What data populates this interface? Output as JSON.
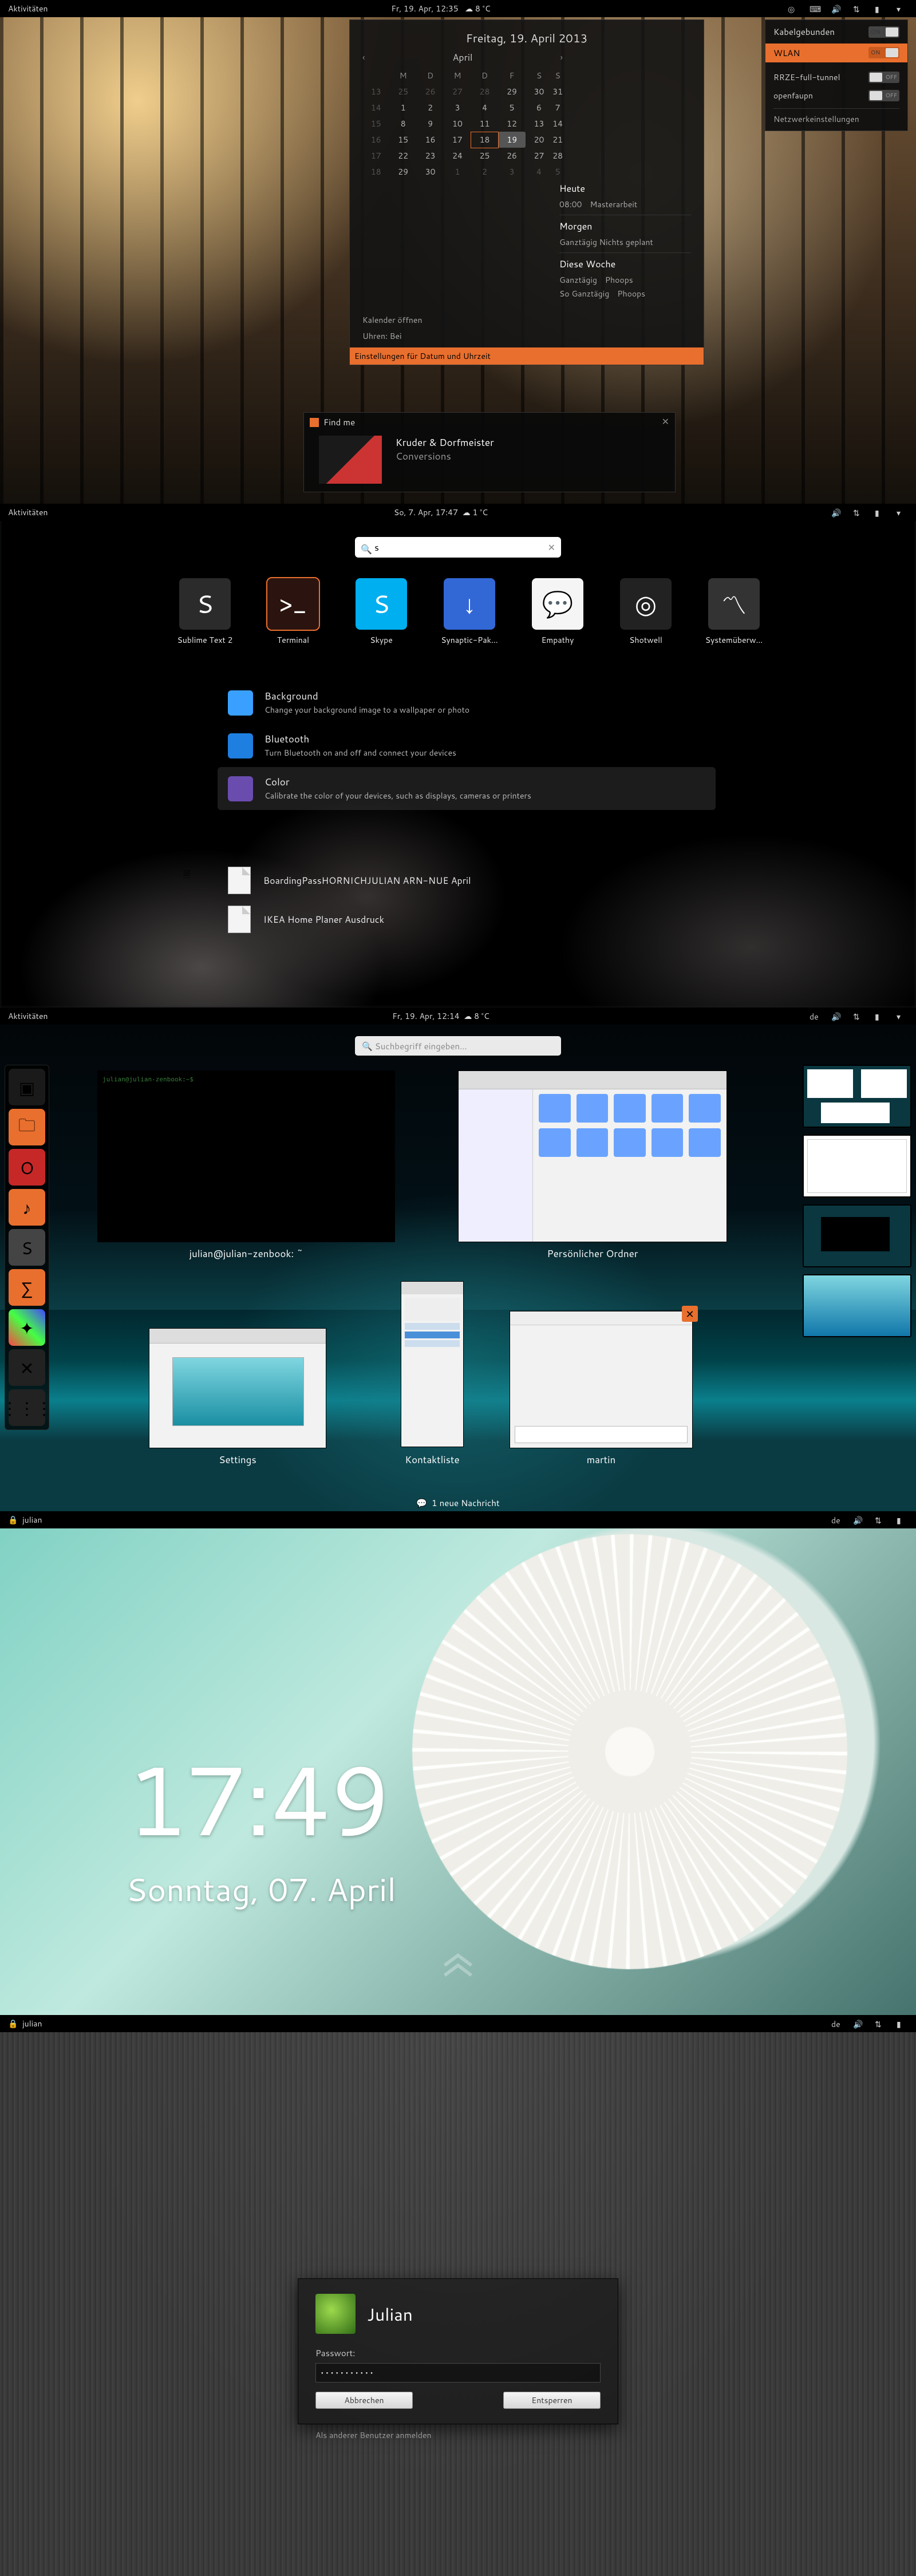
{
  "s1": {
    "topbar": {
      "activities": "Aktivitäten",
      "datetime": "Fr, 19. Apr, 12:35",
      "temp": "8 °C"
    },
    "calendar": {
      "title": "Freitag, 19. April 2013",
      "month": "April",
      "dow": [
        "M",
        "D",
        "M",
        "D",
        "F",
        "S",
        "S"
      ],
      "weeknums": [
        "13",
        "14",
        "15",
        "16",
        "17",
        "18"
      ],
      "days": [
        [
          "25",
          "26",
          "27",
          "28",
          "29",
          "30",
          "31"
        ],
        [
          "1",
          "2",
          "3",
          "4",
          "5",
          "6",
          "7"
        ],
        [
          "8",
          "9",
          "10",
          "11",
          "12",
          "13",
          "14"
        ],
        [
          "15",
          "16",
          "17",
          "18",
          "19",
          "20",
          "21"
        ],
        [
          "22",
          "23",
          "24",
          "25",
          "26",
          "27",
          "28"
        ],
        [
          "29",
          "30",
          "1",
          "2",
          "3",
          "4",
          "5"
        ]
      ],
      "today_r": 3,
      "today_c": 4,
      "hl_r": 3,
      "hl_c": 3,
      "agenda": {
        "today": "Heute",
        "today_time": "08:00",
        "today_text": "Masterarbeit",
        "tomorrow": "Morgen",
        "tomorrow_text": "Ganztägig   Nichts geplant",
        "week": "Diese Woche",
        "rows": [
          [
            "Ganztägig",
            "Phoops"
          ],
          [
            "So   Ganztägig",
            "Phoops"
          ]
        ]
      },
      "open_cal": "Kalender öffnen",
      "show_clocks": "Uhren: Bei",
      "settings": "Einstellungen für Datum und Uhrzeit"
    },
    "net": {
      "wired": "Kabelgebunden",
      "wired_on": true,
      "wlan": "WLAN",
      "wlan_on": true,
      "items": [
        [
          "RRZE-full-tunnel",
          "off"
        ],
        [
          "openfaupn",
          "off"
        ]
      ],
      "settings": "Netzwerkeinstellungen"
    },
    "notif": {
      "title": "Find me",
      "artist": "Kruder & Dorfmeister",
      "track": "Conversions"
    }
  },
  "s2": {
    "topbar": {
      "activities": "Aktivitäten",
      "datetime": "So, 7. Apr, 17:47",
      "temp": "1 °C"
    },
    "query": "s",
    "apps": [
      {
        "name": "Sublime Text 2",
        "color": "#2b2b2b",
        "glyph": "S"
      },
      {
        "name": "Terminal",
        "color": "#2b1410",
        "glyph": ">_",
        "sel": true
      },
      {
        "name": "Skype",
        "color": "#00aff0",
        "glyph": "S"
      },
      {
        "name": "Synaptic-Pak…",
        "color": "#3267d6",
        "glyph": "↓"
      },
      {
        "name": "Empathy",
        "color": "#f5f5f5",
        "glyph": "💬"
      },
      {
        "name": "Shotwell",
        "color": "#222",
        "glyph": "◎"
      },
      {
        "name": "Systemüberw…",
        "color": "#333",
        "glyph": "〽"
      }
    ],
    "settings_label": "⚙",
    "settings": [
      {
        "ic": "#3aa0ff",
        "t": "Background",
        "s": "Change your background image to a wallpaper or photo"
      },
      {
        "ic": "#1f7fe0",
        "t": "Bluetooth",
        "s": "Turn Bluetooth on and off and connect your devices"
      },
      {
        "ic": "#6a4caf",
        "t": "Color",
        "s": "Calibrate the color of your devices, such as displays, cameras or printers",
        "sel": true
      }
    ],
    "files_label": "📄",
    "files": [
      "BoardingPassHORNICHJULIAN ARN-NUE April",
      "IKEA Home Planer Ausdruck"
    ]
  },
  "s3": {
    "topbar": {
      "activities": "Aktivitäten",
      "datetime": "Fr, 19. Apr, 12:14",
      "temp": "8 °C",
      "lang": "de"
    },
    "search_ph": "Suchbegriff eingeben…",
    "windows": {
      "term": "julian@julian-zenbook: ~",
      "files": "Persönlicher Ordner",
      "settings": "Settings",
      "contacts": "Kontaktliste",
      "chat": "martin"
    },
    "msg": "1 neue Nachricht"
  },
  "s4": {
    "topbar": {
      "user": "julian",
      "lang": "de"
    },
    "time": "17:49",
    "date": "Sonntag, 07. April"
  },
  "s5": {
    "topbar": {
      "user": "julian",
      "lang": "de"
    },
    "name": "Julian",
    "pw_label": "Passwort:",
    "pw_value": "●●●●●●●●●●●",
    "cancel": "Abbrechen",
    "unlock": "Entsperren",
    "other": "Als anderer Benutzer anmelden"
  }
}
